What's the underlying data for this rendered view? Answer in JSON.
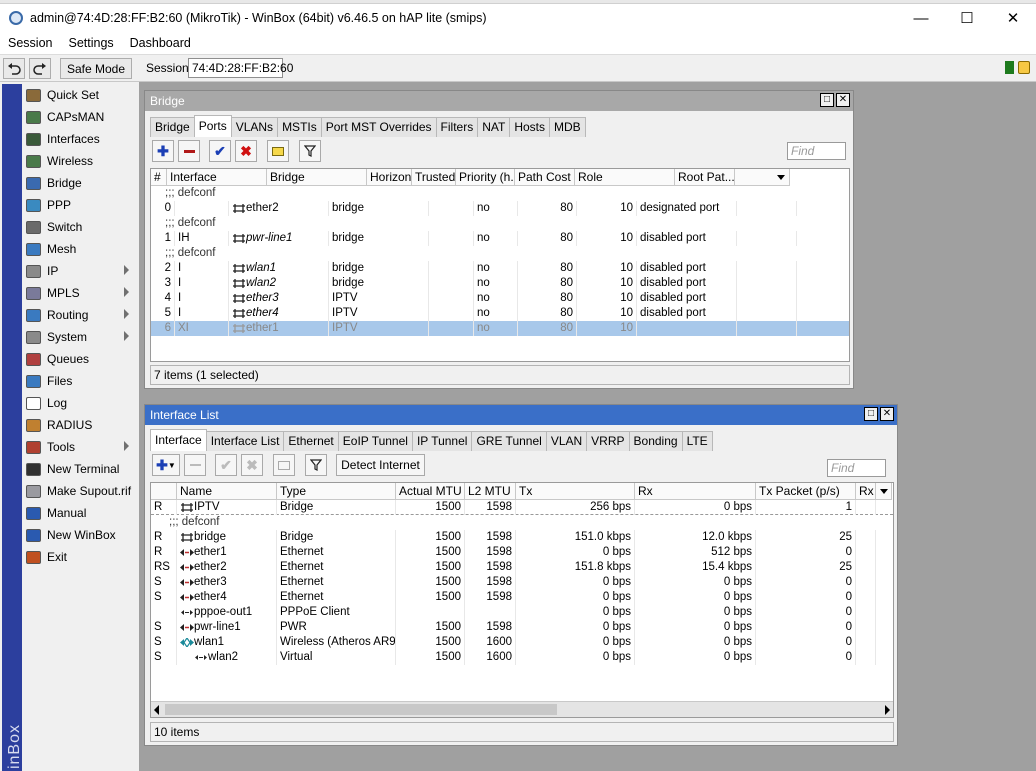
{
  "window": {
    "title": "admin@74:4D:28:FF:B2:60 (MikroTik) - WinBox (64bit) v6.46.5 on hAP lite (smips)",
    "minimize": "—",
    "maximize": "☐",
    "close": "✕"
  },
  "menu": {
    "session": "Session",
    "settings": "Settings",
    "dashboard": "Dashboard"
  },
  "toolbar": {
    "undo_icon": "undo-icon",
    "redo_icon": "redo-icon",
    "safe_mode": "Safe Mode",
    "session_label": "Session:",
    "session_value": "74:4D:28:FF:B2:60"
  },
  "sidebar": {
    "vertical_text": "inBox",
    "items": [
      {
        "label": "Quick Set",
        "icon": "quickset-icon",
        "color": "#8a6a3a",
        "submenu": false
      },
      {
        "label": "CAPsMAN",
        "icon": "capsman-icon",
        "color": "#4a7a4a",
        "submenu": false
      },
      {
        "label": "Interfaces",
        "icon": "interfaces-icon",
        "color": "#3a5a3a",
        "submenu": false
      },
      {
        "label": "Wireless",
        "icon": "wireless-icon",
        "color": "#4a7a4a",
        "submenu": false
      },
      {
        "label": "Bridge",
        "icon": "bridge-icon",
        "color": "#3a6ab0",
        "submenu": false
      },
      {
        "label": "PPP",
        "icon": "ppp-icon",
        "color": "#3a8ac0",
        "submenu": false
      },
      {
        "label": "Switch",
        "icon": "switch-icon",
        "color": "#6a6a6a",
        "submenu": false
      },
      {
        "label": "Mesh",
        "icon": "mesh-icon",
        "color": "#3a7ac0",
        "submenu": false
      },
      {
        "label": "IP",
        "icon": "ip-icon",
        "color": "#8a8a8a",
        "submenu": true
      },
      {
        "label": "MPLS",
        "icon": "mpls-icon",
        "color": "#7a7a9a",
        "submenu": true
      },
      {
        "label": "Routing",
        "icon": "routing-icon",
        "color": "#3a7ac0",
        "submenu": true
      },
      {
        "label": "System",
        "icon": "system-icon",
        "color": "#8a8a8a",
        "submenu": true
      },
      {
        "label": "Queues",
        "icon": "queues-icon",
        "color": "#b04040",
        "submenu": false
      },
      {
        "label": "Files",
        "icon": "files-icon",
        "color": "#3a7ac0",
        "submenu": false
      },
      {
        "label": "Log",
        "icon": "log-icon",
        "color": "#ffffff",
        "submenu": false
      },
      {
        "label": "RADIUS",
        "icon": "radius-icon",
        "color": "#c08030",
        "submenu": false
      },
      {
        "label": "Tools",
        "icon": "tools-icon",
        "color": "#b04030",
        "submenu": true
      },
      {
        "label": "New Terminal",
        "icon": "terminal-icon",
        "color": "#303030",
        "submenu": false
      },
      {
        "label": "Make Supout.rif",
        "icon": "supout-icon",
        "color": "#9a9aa0",
        "submenu": false
      },
      {
        "label": "Manual",
        "icon": "manual-icon",
        "color": "#2a5ab0",
        "submenu": false
      },
      {
        "label": "New WinBox",
        "icon": "winbox-icon",
        "color": "#2a5ab0",
        "submenu": false
      },
      {
        "label": "Exit",
        "icon": "exit-icon",
        "color": "#c05020",
        "submenu": false
      }
    ]
  },
  "bridge_window": {
    "title": "Bridge",
    "tabs": [
      "Bridge",
      "Ports",
      "VLANs",
      "MSTIs",
      "Port MST Overrides",
      "Filters",
      "NAT",
      "Hosts",
      "MDB"
    ],
    "selected_tab": "Ports",
    "find_placeholder": "Find",
    "columns": [
      "#",
      "Interface",
      "Bridge",
      "Horizon",
      "Trusted",
      "Priority (h...",
      "Path Cost",
      "Role",
      "Root Pat..."
    ],
    "rows": [
      {
        "type": "comment",
        "text": ";;; defconf"
      },
      {
        "num": "0",
        "flags": "",
        "iface": "ether2",
        "italic": false,
        "bridge": "bridge",
        "horizon": "",
        "trusted": "no",
        "priority": "80",
        "cost": "10",
        "role": "designated port",
        "rootpath": ""
      },
      {
        "type": "comment",
        "text": ";;; defconf"
      },
      {
        "num": "1",
        "flags": "IH",
        "iface": "pwr-line1",
        "italic": true,
        "bridge": "bridge",
        "horizon": "",
        "trusted": "no",
        "priority": "80",
        "cost": "10",
        "role": "disabled port",
        "rootpath": ""
      },
      {
        "type": "comment",
        "text": ";;; defconf"
      },
      {
        "num": "2",
        "flags": "I",
        "iface": "wlan1",
        "italic": true,
        "bridge": "bridge",
        "horizon": "",
        "trusted": "no",
        "priority": "80",
        "cost": "10",
        "role": "disabled port",
        "rootpath": ""
      },
      {
        "num": "3",
        "flags": "I",
        "iface": "wlan2",
        "italic": true,
        "bridge": "bridge",
        "horizon": "",
        "trusted": "no",
        "priority": "80",
        "cost": "10",
        "role": "disabled port",
        "rootpath": ""
      },
      {
        "num": "4",
        "flags": "I",
        "iface": "ether3",
        "italic": true,
        "bridge": "IPTV",
        "horizon": "",
        "trusted": "no",
        "priority": "80",
        "cost": "10",
        "role": "disabled port",
        "rootpath": ""
      },
      {
        "num": "5",
        "flags": "I",
        "iface": "ether4",
        "italic": true,
        "bridge": "IPTV",
        "horizon": "",
        "trusted": "no",
        "priority": "80",
        "cost": "10",
        "role": "disabled port",
        "rootpath": ""
      },
      {
        "num": "6",
        "flags": "XI",
        "iface": "ether1",
        "italic": false,
        "bridge": "IPTV",
        "horizon": "",
        "trusted": "no",
        "priority": "80",
        "cost": "10",
        "role": "",
        "rootpath": "",
        "selected": true
      }
    ],
    "status": "7 items (1 selected)"
  },
  "iface_window": {
    "title": "Interface List",
    "tabs": [
      "Interface",
      "Interface List",
      "Ethernet",
      "EoIP Tunnel",
      "IP Tunnel",
      "GRE Tunnel",
      "VLAN",
      "VRRP",
      "Bonding",
      "LTE"
    ],
    "selected_tab": "Interface",
    "detect_button": "Detect Internet",
    "find_placeholder": "Find",
    "columns": [
      "",
      "Name",
      "Type",
      "Actual MTU",
      "L2 MTU",
      "Tx",
      "Rx",
      "Tx Packet (p/s)",
      "Rx"
    ],
    "rows": [
      {
        "flag": "R",
        "name": "IPTV",
        "indent": 0,
        "kind": "bridge",
        "type": "Bridge",
        "mtu": "1500",
        "l2mtu": "1598",
        "tx": "256 bps",
        "rx": "0 bps",
        "txp": "1"
      },
      {
        "type_row": "comment",
        "text": ";;; defconf"
      },
      {
        "flag": "R",
        "name": "bridge",
        "indent": 0,
        "kind": "bridge",
        "type": "Bridge",
        "mtu": "1500",
        "l2mtu": "1598",
        "tx": "151.0 kbps",
        "rx": "12.0 kbps",
        "txp": "25"
      },
      {
        "flag": "R",
        "name": "ether1",
        "indent": 0,
        "kind": "eth",
        "type": "Ethernet",
        "mtu": "1500",
        "l2mtu": "1598",
        "tx": "0 bps",
        "rx": "512 bps",
        "txp": "0"
      },
      {
        "flag": "RS",
        "name": "ether2",
        "indent": 0,
        "kind": "eth",
        "type": "Ethernet",
        "mtu": "1500",
        "l2mtu": "1598",
        "tx": "151.8 kbps",
        "rx": "15.4 kbps",
        "txp": "25"
      },
      {
        "flag": "S",
        "name": "ether3",
        "indent": 0,
        "kind": "eth",
        "type": "Ethernet",
        "mtu": "1500",
        "l2mtu": "1598",
        "tx": "0 bps",
        "rx": "0 bps",
        "txp": "0"
      },
      {
        "flag": "S",
        "name": "ether4",
        "indent": 0,
        "kind": "eth",
        "type": "Ethernet",
        "mtu": "1500",
        "l2mtu": "1598",
        "tx": "0 bps",
        "rx": "0 bps",
        "txp": "0"
      },
      {
        "flag": "",
        "name": "pppoe-out1",
        "indent": 0,
        "kind": "ppp",
        "type": "PPPoE Client",
        "mtu": "",
        "l2mtu": "",
        "tx": "0 bps",
        "rx": "0 bps",
        "txp": "0"
      },
      {
        "flag": "S",
        "name": "pwr-line1",
        "indent": 0,
        "kind": "eth",
        "type": "PWR",
        "mtu": "1500",
        "l2mtu": "1598",
        "tx": "0 bps",
        "rx": "0 bps",
        "txp": "0"
      },
      {
        "flag": "S",
        "name": "wlan1",
        "indent": 0,
        "kind": "wifi",
        "type": "Wireless (Atheros AR9...",
        "mtu": "1500",
        "l2mtu": "1600",
        "tx": "0 bps",
        "rx": "0 bps",
        "txp": "0"
      },
      {
        "flag": "S",
        "name": "wlan2",
        "indent": 1,
        "kind": "ppp",
        "type": "Virtual",
        "mtu": "1500",
        "l2mtu": "1600",
        "tx": "0 bps",
        "rx": "0 bps",
        "txp": "0"
      }
    ],
    "status": "10 items"
  }
}
